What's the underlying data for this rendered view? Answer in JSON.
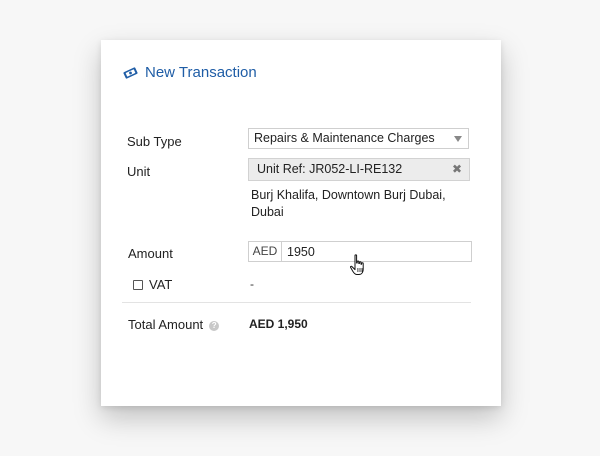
{
  "form": {
    "title": "New Transaction",
    "title_icon": "money-icon",
    "accent_color": "#1f5da6",
    "sub_type": {
      "label": "Sub Type",
      "selected": "Repairs & Maintenance Charges"
    },
    "unit": {
      "label": "Unit",
      "tag": "Unit Ref: JR052-LI-RE132",
      "remove_symbol": "✖",
      "address": "Burj Khalifa, Downtown Burj Dubai, Dubai"
    },
    "amount": {
      "label": "Amount",
      "currency": "AED",
      "value": "1950"
    },
    "vat": {
      "label": "VAT",
      "value": "-"
    },
    "total": {
      "label": "Total Amount",
      "help_symbol": "?",
      "value": "AED 1,950"
    }
  }
}
